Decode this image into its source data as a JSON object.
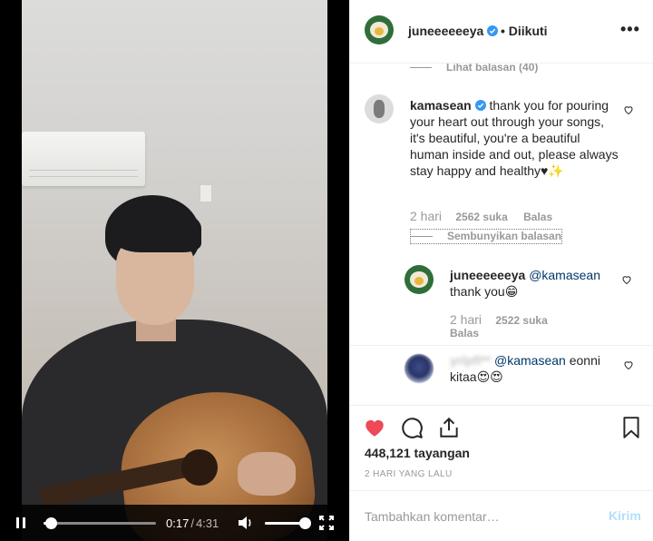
{
  "video": {
    "current_time": "0:17",
    "separator": "/",
    "duration": "4:31",
    "progress_fraction": 0.063,
    "volume_fraction": 1.0
  },
  "header": {
    "username": "juneeeeeeya",
    "follow_status": "• Diikuti",
    "more": "•••"
  },
  "comments": {
    "view_replies": "Lihat balasan (40)",
    "main": {
      "username": "kamasean",
      "text": "thank you for pouring your heart out through your songs, it's beautiful, you're a beautiful human inside and out, please always stay happy and healthy♥✨",
      "time": "2 hari",
      "likes": "2562 suka",
      "reply": "Balas"
    },
    "hide_replies": "Sembunyikan balasan",
    "reply1": {
      "username": "juneeeeeeya",
      "mention": "@kamasean",
      "text": "thank you😁",
      "time": "2 hari",
      "likes": "2522 suka",
      "reply": "Balas"
    },
    "reply2": {
      "username": "yrlpfl**",
      "mention": "@kamasean",
      "text_inline": "eonni",
      "text_next": "kitaa😍😍"
    }
  },
  "actions": {
    "views": "448,121 tayangan",
    "posted": "2 HARI YANG LALU"
  },
  "add_comment": {
    "placeholder": "Tambahkan komentar…",
    "post_label": "Kirim"
  },
  "colors": {
    "like_red": "#ed4956",
    "verified_blue": "#3897f0",
    "mention": "#00376b",
    "post_disabled": "#b2dffc"
  },
  "icons": [
    "pause-icon",
    "volume-icon",
    "fullscreen-icon",
    "heart-filled-icon",
    "comment-icon",
    "share-icon",
    "bookmark-icon",
    "heart-outline-icon",
    "verified-badge-icon"
  ]
}
